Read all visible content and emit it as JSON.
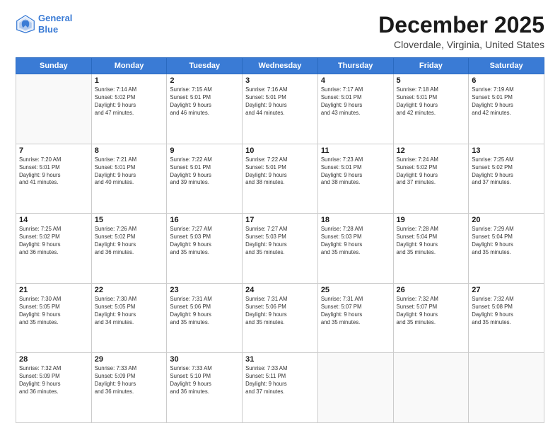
{
  "header": {
    "logo": {
      "line1": "General",
      "line2": "Blue"
    },
    "title": "December 2025",
    "subtitle": "Cloverdale, Virginia, United States"
  },
  "days_of_week": [
    "Sunday",
    "Monday",
    "Tuesday",
    "Wednesday",
    "Thursday",
    "Friday",
    "Saturday"
  ],
  "weeks": [
    [
      {
        "day": "",
        "info": ""
      },
      {
        "day": "1",
        "info": "Sunrise: 7:14 AM\nSunset: 5:02 PM\nDaylight: 9 hours\nand 47 minutes."
      },
      {
        "day": "2",
        "info": "Sunrise: 7:15 AM\nSunset: 5:01 PM\nDaylight: 9 hours\nand 46 minutes."
      },
      {
        "day": "3",
        "info": "Sunrise: 7:16 AM\nSunset: 5:01 PM\nDaylight: 9 hours\nand 44 minutes."
      },
      {
        "day": "4",
        "info": "Sunrise: 7:17 AM\nSunset: 5:01 PM\nDaylight: 9 hours\nand 43 minutes."
      },
      {
        "day": "5",
        "info": "Sunrise: 7:18 AM\nSunset: 5:01 PM\nDaylight: 9 hours\nand 42 minutes."
      },
      {
        "day": "6",
        "info": "Sunrise: 7:19 AM\nSunset: 5:01 PM\nDaylight: 9 hours\nand 42 minutes."
      }
    ],
    [
      {
        "day": "7",
        "info": "Sunrise: 7:20 AM\nSunset: 5:01 PM\nDaylight: 9 hours\nand 41 minutes."
      },
      {
        "day": "8",
        "info": "Sunrise: 7:21 AM\nSunset: 5:01 PM\nDaylight: 9 hours\nand 40 minutes."
      },
      {
        "day": "9",
        "info": "Sunrise: 7:22 AM\nSunset: 5:01 PM\nDaylight: 9 hours\nand 39 minutes."
      },
      {
        "day": "10",
        "info": "Sunrise: 7:22 AM\nSunset: 5:01 PM\nDaylight: 9 hours\nand 38 minutes."
      },
      {
        "day": "11",
        "info": "Sunrise: 7:23 AM\nSunset: 5:01 PM\nDaylight: 9 hours\nand 38 minutes."
      },
      {
        "day": "12",
        "info": "Sunrise: 7:24 AM\nSunset: 5:02 PM\nDaylight: 9 hours\nand 37 minutes."
      },
      {
        "day": "13",
        "info": "Sunrise: 7:25 AM\nSunset: 5:02 PM\nDaylight: 9 hours\nand 37 minutes."
      }
    ],
    [
      {
        "day": "14",
        "info": "Sunrise: 7:25 AM\nSunset: 5:02 PM\nDaylight: 9 hours\nand 36 minutes."
      },
      {
        "day": "15",
        "info": "Sunrise: 7:26 AM\nSunset: 5:02 PM\nDaylight: 9 hours\nand 36 minutes."
      },
      {
        "day": "16",
        "info": "Sunrise: 7:27 AM\nSunset: 5:03 PM\nDaylight: 9 hours\nand 35 minutes."
      },
      {
        "day": "17",
        "info": "Sunrise: 7:27 AM\nSunset: 5:03 PM\nDaylight: 9 hours\nand 35 minutes."
      },
      {
        "day": "18",
        "info": "Sunrise: 7:28 AM\nSunset: 5:03 PM\nDaylight: 9 hours\nand 35 minutes."
      },
      {
        "day": "19",
        "info": "Sunrise: 7:28 AM\nSunset: 5:04 PM\nDaylight: 9 hours\nand 35 minutes."
      },
      {
        "day": "20",
        "info": "Sunrise: 7:29 AM\nSunset: 5:04 PM\nDaylight: 9 hours\nand 35 minutes."
      }
    ],
    [
      {
        "day": "21",
        "info": "Sunrise: 7:30 AM\nSunset: 5:05 PM\nDaylight: 9 hours\nand 35 minutes."
      },
      {
        "day": "22",
        "info": "Sunrise: 7:30 AM\nSunset: 5:05 PM\nDaylight: 9 hours\nand 34 minutes."
      },
      {
        "day": "23",
        "info": "Sunrise: 7:31 AM\nSunset: 5:06 PM\nDaylight: 9 hours\nand 35 minutes."
      },
      {
        "day": "24",
        "info": "Sunrise: 7:31 AM\nSunset: 5:06 PM\nDaylight: 9 hours\nand 35 minutes."
      },
      {
        "day": "25",
        "info": "Sunrise: 7:31 AM\nSunset: 5:07 PM\nDaylight: 9 hours\nand 35 minutes."
      },
      {
        "day": "26",
        "info": "Sunrise: 7:32 AM\nSunset: 5:07 PM\nDaylight: 9 hours\nand 35 minutes."
      },
      {
        "day": "27",
        "info": "Sunrise: 7:32 AM\nSunset: 5:08 PM\nDaylight: 9 hours\nand 35 minutes."
      }
    ],
    [
      {
        "day": "28",
        "info": "Sunrise: 7:32 AM\nSunset: 5:09 PM\nDaylight: 9 hours\nand 36 minutes."
      },
      {
        "day": "29",
        "info": "Sunrise: 7:33 AM\nSunset: 5:09 PM\nDaylight: 9 hours\nand 36 minutes."
      },
      {
        "day": "30",
        "info": "Sunrise: 7:33 AM\nSunset: 5:10 PM\nDaylight: 9 hours\nand 36 minutes."
      },
      {
        "day": "31",
        "info": "Sunrise: 7:33 AM\nSunset: 5:11 PM\nDaylight: 9 hours\nand 37 minutes."
      },
      {
        "day": "",
        "info": ""
      },
      {
        "day": "",
        "info": ""
      },
      {
        "day": "",
        "info": ""
      }
    ]
  ]
}
